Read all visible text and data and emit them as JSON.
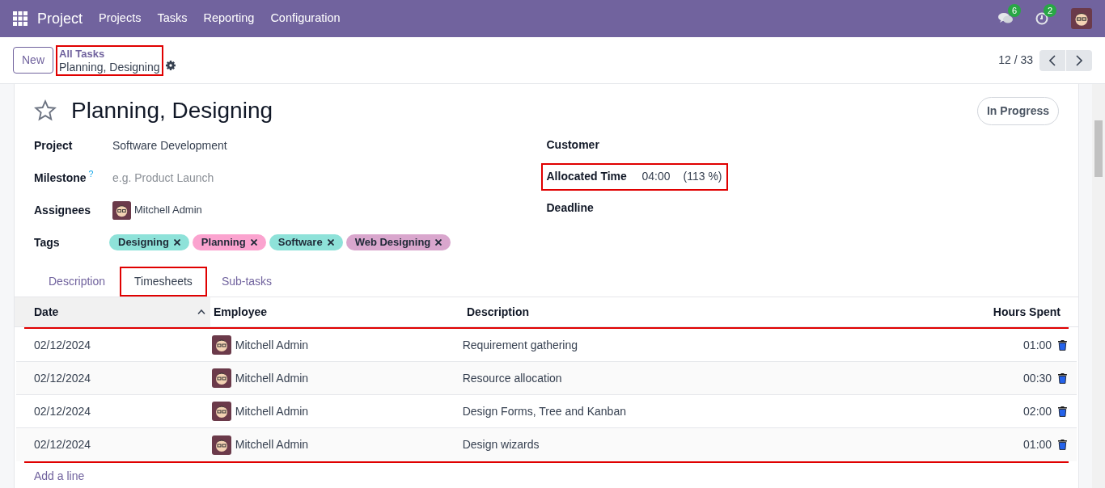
{
  "navbar": {
    "app": "Project",
    "menu": [
      "Projects",
      "Tasks",
      "Reporting",
      "Configuration"
    ],
    "messages_count": "6",
    "activities_count": "2"
  },
  "control_panel": {
    "new_button": "New",
    "breadcrumb_parent": "All Tasks",
    "breadcrumb_current": "Planning, Designing",
    "breadcrumb_highlighted": true,
    "pager": "12 / 33"
  },
  "task": {
    "starred": false,
    "title": "Planning, Designing",
    "stage": "In Progress",
    "left_fields": [
      {
        "kind": "text",
        "label": "Project",
        "value": "Software Development"
      },
      {
        "kind": "placeholder",
        "label": "Milestone",
        "help": "?",
        "placeholder": "e.g. Product Launch"
      },
      {
        "kind": "user",
        "label": "Assignees",
        "value": "Mitchell Admin"
      },
      {
        "kind": "tags",
        "label": "Tags",
        "tags": [
          {
            "label": "Designing",
            "color": "#8ee2d9"
          },
          {
            "label": "Planning",
            "color": "#fba3cf"
          },
          {
            "label": "Software",
            "color": "#8ee2d9"
          },
          {
            "label": "Web Designing",
            "color": "#d9a6cd"
          }
        ]
      }
    ],
    "right_fields": [
      {
        "kind": "empty",
        "label": "Customer",
        "highlighted": false
      },
      {
        "kind": "time",
        "label": "Allocated Time",
        "value": "04:00",
        "percent": "(113 %)",
        "highlighted": true
      },
      {
        "kind": "empty",
        "label": "Deadline",
        "highlighted": false
      }
    ]
  },
  "tabs": [
    {
      "label": "Description",
      "selected": false,
      "highlighted": false
    },
    {
      "label": "Timesheets",
      "selected": true,
      "highlighted": true
    },
    {
      "label": "Sub-tasks",
      "selected": false,
      "highlighted": false
    }
  ],
  "table": {
    "columns": [
      "Date",
      "Employee",
      "Description",
      "Hours Spent"
    ],
    "rows_highlighted": true,
    "rows": [
      {
        "date": "02/12/2024",
        "employee": "Mitchell Admin",
        "description": "Requirement gathering",
        "hours": "01:00"
      },
      {
        "date": "02/12/2024",
        "employee": "Mitchell Admin",
        "description": "Resource allocation",
        "hours": "00:30"
      },
      {
        "date": "02/12/2024",
        "employee": "Mitchell Admin",
        "description": "Design Forms, Tree and Kanban",
        "hours": "02:00"
      },
      {
        "date": "02/12/2024",
        "employee": "Mitchell Admin",
        "description": "Design wizards",
        "hours": "01:00"
      }
    ],
    "add_line": "Add a line"
  }
}
